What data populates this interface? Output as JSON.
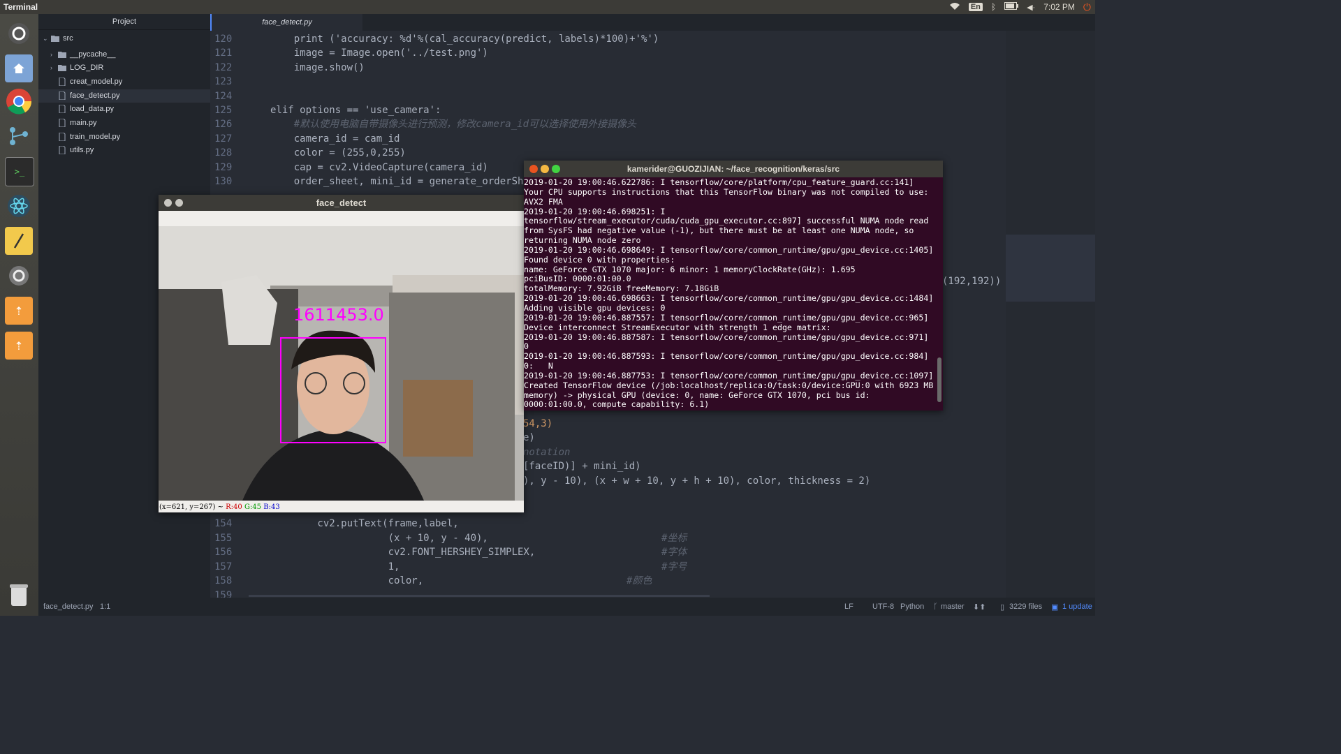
{
  "topbar": {
    "app_title": "Terminal",
    "lang": "En",
    "time": "7:02 PM",
    "icons": [
      "wifi-icon",
      "bluetooth-icon",
      "battery-icon",
      "volume-icon",
      "power-icon"
    ]
  },
  "launcher": {
    "items": [
      "ubuntu-dash-icon",
      "files-home-icon",
      "chrome-icon",
      "git-icon",
      "terminal-icon",
      "atom-icon",
      "text-editor-icon",
      "settings-icon",
      "usb-drive-icon",
      "usb-drive-icon",
      "trash-icon"
    ]
  },
  "tree": {
    "header": "Project",
    "items": [
      {
        "label": "src",
        "type": "folder-open"
      },
      {
        "label": "__pycache__",
        "type": "folder"
      },
      {
        "label": "LOG_DIR",
        "type": "folder"
      },
      {
        "label": "creat_model.py",
        "type": "file"
      },
      {
        "label": "face_detect.py",
        "type": "file",
        "selected": true
      },
      {
        "label": "load_data.py",
        "type": "file"
      },
      {
        "label": "main.py",
        "type": "file"
      },
      {
        "label": "train_model.py",
        "type": "file"
      },
      {
        "label": "utils.py",
        "type": "file"
      }
    ]
  },
  "editor": {
    "tab_label": "face_detect.py",
    "lines": [
      {
        "n": "120",
        "code": "    print ('accuracy: %d'%(cal_accuracy(predict, labels)*100)+'%')"
      },
      {
        "n": "121",
        "code": "    image = Image.open('../test.png')"
      },
      {
        "n": "122",
        "code": "    image.show()"
      },
      {
        "n": "123",
        "code": ""
      },
      {
        "n": "124",
        "code": ""
      },
      {
        "n": "125",
        "code": "elif options == 'use_camera':"
      },
      {
        "n": "126",
        "code": "    #默认使用电脑自带摄像头进行预测，修改camera_id可以选择使用外接摄像头"
      },
      {
        "n": "127",
        "code": "    camera_id = cam_id"
      },
      {
        "n": "128",
        "code": "    color = (255,0,255)"
      },
      {
        "n": "129",
        "code": "    cap = cv2.VideoCapture(camera_id)"
      },
      {
        "n": "130",
        "code": "    order_sheet, mini_id = generate_orderShe"
      }
    ],
    "partial_lines": [
      {
        "code": "(192,192))"
      },
      {
        "code": "54,3)"
      },
      {
        "code": "e)"
      },
      {
        "code": "notation"
      },
      {
        "code": "[faceID)] + mini_id)"
      },
      {
        "code": "), y - 10), (x + w + 10, y + h + 10), color, thickness = 2)"
      }
    ],
    "bottom_lines": [
      {
        "n": "154",
        "code": "        cv2.putText(frame,label,",
        "comment": ""
      },
      {
        "n": "155",
        "code": "                    (x + 10, y - 40),",
        "comment": "#坐标"
      },
      {
        "n": "156",
        "code": "                    cv2.FONT_HERSHEY_SIMPLEX,",
        "comment": "#字体"
      },
      {
        "n": "157",
        "code": "                    1,",
        "comment": "#字号"
      },
      {
        "n": "158",
        "code": "                    color,",
        "comment": "#颜色"
      },
      {
        "n": "159",
        "code": "",
        "comment": ""
      }
    ]
  },
  "face_window": {
    "title": "face_detect",
    "label_text": "1611453.0",
    "coord_text": "(x=621, y=267) ~",
    "r": "R:40",
    "g": "G:45",
    "b": "B:43"
  },
  "terminal": {
    "title": "kamerider@GUOZIJIAN: ~/face_recognition/keras/src",
    "output": "2019-01-20 19:00:46.622786: I tensorflow/core/platform/cpu_feature_guard.cc:141] Your CPU supports instructions that this TensorFlow binary was not compiled to use: AVX2 FMA\n2019-01-20 19:00:46.698251: I tensorflow/stream_executor/cuda/cuda_gpu_executor.cc:897] successful NUMA node read from SysFS had negative value (-1), but there must be at least one NUMA node, so returning NUMA node zero\n2019-01-20 19:00:46.698649: I tensorflow/core/common_runtime/gpu/gpu_device.cc:1405] Found device 0 with properties:\nname: GeForce GTX 1070 major: 6 minor: 1 memoryClockRate(GHz): 1.695\npciBusID: 0000:01:00.0\ntotalMemory: 7.92GiB freeMemory: 7.18GiB\n2019-01-20 19:00:46.698663: I tensorflow/core/common_runtime/gpu/gpu_device.cc:1484] Adding visible gpu devices: 0\n2019-01-20 19:00:46.887557: I tensorflow/core/common_runtime/gpu/gpu_device.cc:965] Device interconnect StreamExecutor with strength 1 edge matrix:\n2019-01-20 19:00:46.887587: I tensorflow/core/common_runtime/gpu/gpu_device.cc:971]      0\n2019-01-20 19:00:46.887593: I tensorflow/core/common_runtime/gpu/gpu_device.cc:984] 0:   N\n2019-01-20 19:00:46.887753: I tensorflow/core/common_runtime/gpu/gpu_device.cc:1097] Created TensorFlow device (/job:localhost/replica:0/task:0/device:GPU:0 with 6923 MB memory) -> physical GPU (device: 0, name: GeForce GTX 1070, pci bus id: 0000:01:00.0, compute capability: 6.1)\n█"
  },
  "status": {
    "file": "face_detect.py",
    "cursor": "1:1",
    "eol": "LF",
    "encoding": "UTF-8",
    "grammar": "Python",
    "branch": "master",
    "files": "3229 files",
    "update": "1 update"
  }
}
